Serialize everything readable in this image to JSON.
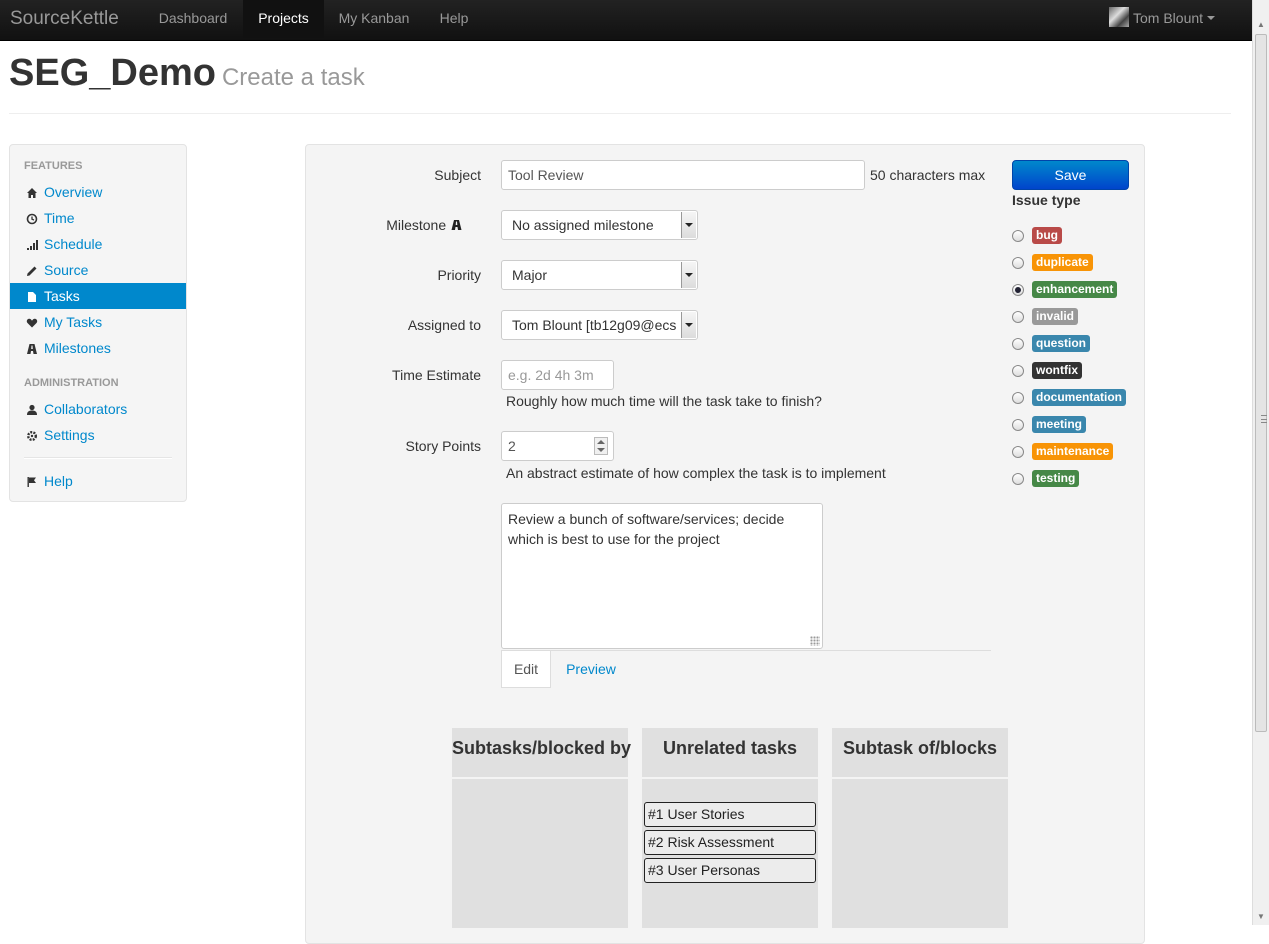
{
  "navbar": {
    "brand": "SourceKettle",
    "items": [
      {
        "label": "Dashboard"
      },
      {
        "label": "Projects"
      },
      {
        "label": "My Kanban"
      },
      {
        "label": "Help"
      }
    ],
    "active": "Projects",
    "user": "Tom Blount"
  },
  "header": {
    "title": "SEG_Demo",
    "subtitle": "Create a task"
  },
  "sidebar": {
    "features_header": "FEATURES",
    "features": [
      {
        "label": "Overview",
        "icon": "home-icon"
      },
      {
        "label": "Time",
        "icon": "clock-icon"
      },
      {
        "label": "Schedule",
        "icon": "signal-icon"
      },
      {
        "label": "Source",
        "icon": "pencil-icon"
      },
      {
        "label": "Tasks",
        "icon": "file-icon"
      },
      {
        "label": "My Tasks",
        "icon": "heart-icon"
      },
      {
        "label": "Milestones",
        "icon": "road-icon"
      }
    ],
    "admin_header": "ADMINISTRATION",
    "admin": [
      {
        "label": "Collaborators",
        "icon": "user-icon"
      },
      {
        "label": "Settings",
        "icon": "cog-icon"
      }
    ],
    "help": {
      "label": "Help",
      "icon": "flag-icon"
    },
    "active": "Tasks"
  },
  "form": {
    "subject": {
      "label": "Subject",
      "value": "Tool Review",
      "hint": "50 characters max"
    },
    "milestone": {
      "label": "Milestone",
      "value": "No assigned milestone"
    },
    "priority": {
      "label": "Priority",
      "value": "Major"
    },
    "assigned": {
      "label": "Assigned to",
      "value": "Tom Blount [tb12g09@ecs"
    },
    "time_estimate": {
      "label": "Time Estimate",
      "placeholder": "e.g. 2d 4h 3m",
      "hint": "Roughly how much time will the task take to finish?"
    },
    "story_points": {
      "label": "Story Points",
      "value": "2",
      "hint": "An abstract estimate of how complex the task is to implement"
    },
    "description_line1": "Review a bunch of software/services; decide",
    "description_line2": "which is best to use for the project",
    "tabs": [
      {
        "label": "Edit"
      },
      {
        "label": "Preview"
      }
    ],
    "active_tab": "Edit"
  },
  "actions": {
    "save_label": "Save"
  },
  "issue_types": {
    "title": "Issue type",
    "selected": "enhancement",
    "options": [
      {
        "label": "bug",
        "color": "#b94a48"
      },
      {
        "label": "duplicate",
        "color": "#f89406"
      },
      {
        "label": "enhancement",
        "color": "#468847"
      },
      {
        "label": "invalid",
        "color": "#999999"
      },
      {
        "label": "question",
        "color": "#3a87ad"
      },
      {
        "label": "wontfix",
        "color": "#333333"
      },
      {
        "label": "documentation",
        "color": "#3a87ad"
      },
      {
        "label": "meeting",
        "color": "#3a87ad"
      },
      {
        "label": "maintenance",
        "color": "#f89406"
      },
      {
        "label": "testing",
        "color": "#468847"
      }
    ]
  },
  "relations": {
    "columns": [
      {
        "title": "Subtasks/blocked by",
        "items": []
      },
      {
        "title": "Unrelated tasks",
        "items": [
          "#1 User Stories",
          "#2 Risk Assessment",
          "#3 User Personas"
        ]
      },
      {
        "title": "Subtask of/blocks",
        "items": []
      }
    ]
  }
}
